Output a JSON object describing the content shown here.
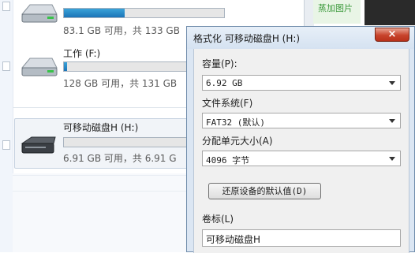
{
  "explorer": {
    "drives": [
      {
        "name": "",
        "info": "83.1 GB 可用，共 133 GB",
        "usage": 0.38
      },
      {
        "name": "工作 (F:)",
        "info": "128 GB 可用，共 131 GB",
        "usage": 0.02
      },
      {
        "name": "可移动磁盘H (H:)",
        "info": "6.91 GB 可用，共 6.91 G",
        "usage": 0.0
      }
    ]
  },
  "background": {
    "green_text": "蒸加图片"
  },
  "dialog": {
    "title": "格式化 可移动磁盘H (H:)",
    "close_symbol": "×",
    "capacity": {
      "label": "容量(P):",
      "value": "6.92 GB"
    },
    "filesystem": {
      "label": "文件系统(F)",
      "value": "FAT32 (默认)"
    },
    "allocation": {
      "label": "分配单元大小(A)",
      "value": "4096 字节"
    },
    "restore_button": "还原设备的默认值(D)",
    "volume": {
      "label": "卷标(L)",
      "value": "可移动磁盘H"
    }
  },
  "colors": {
    "usage_bar": "#1b75b8",
    "close_button": "#c8432b",
    "dialog_frame": "#dbe6f3"
  }
}
